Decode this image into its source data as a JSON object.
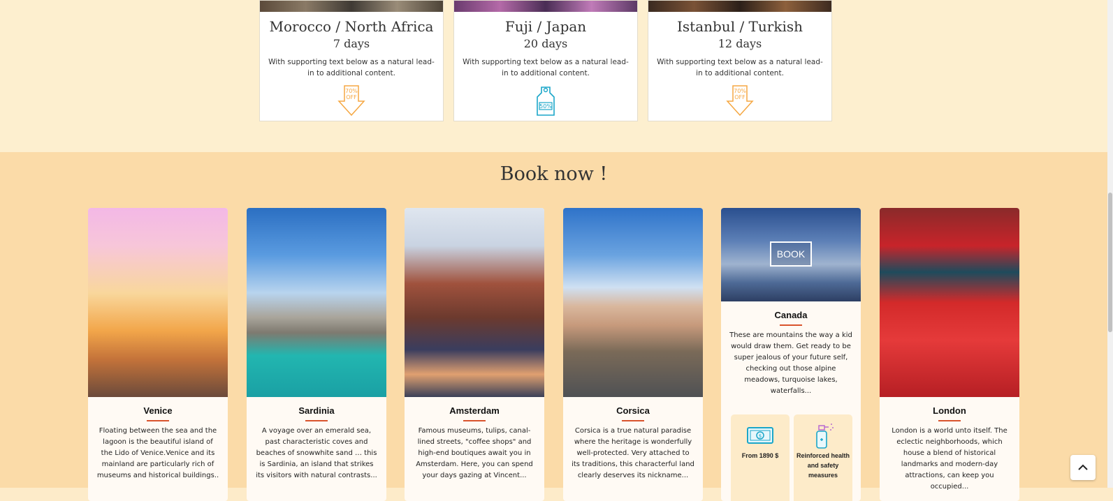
{
  "deals": [
    {
      "title": "Morocco / North Africa",
      "days": "7 days",
      "text": "With supporting text below as a natural lead-in to additional content.",
      "badge_icon": "70-percent-off-tag-icon",
      "badge_text": "70% OFF",
      "badge_color": "#f5a742"
    },
    {
      "title": "Fuji / Japan",
      "days": "20 days",
      "text": "With supporting text below as a natural lead-in to additional content.",
      "badge_icon": "50-percent-price-tag-icon",
      "badge_text": "50%",
      "badge_color": "#1aa6c9"
    },
    {
      "title": "Istanbul / Turkish",
      "days": "12 days",
      "text": "With supporting text below as a natural lead-in to additional content.",
      "badge_icon": "70-percent-off-tag-icon",
      "badge_text": "70% OFF",
      "badge_color": "#f5a742"
    }
  ],
  "book_section": {
    "title": "Book now !",
    "destinations": [
      {
        "name": "Venice",
        "desc": "Floating between the sea and the lagoon is the beautiful island of the Lido of Venice.Venice and its mainland are particularly rich of museums and historical buildings.."
      },
      {
        "name": "Sardinia",
        "desc": "A voyage over an emerald sea, past characteristic coves and beaches of snowwhite sand … this is Sardinia, an island that strikes its visitors with natural contrasts..."
      },
      {
        "name": "Amsterdam",
        "desc": "Famous museums, tulips, canal-lined streets, \"coffee shops\" and high-end boutiques await you in Amsterdam. Here, you can spend your days gazing at Vincent..."
      },
      {
        "name": "Corsica",
        "desc": "Corsica is a true natural paradise where the heritage is wonderfully well-protected. Very attached to its traditions, this characterful land clearly deserves its nickname..."
      },
      {
        "name": "London",
        "desc": "London is a world unto itself. The eclectic neighborhoods, which house a blend of historical landmarks and modern-day attractions, can keep you occupied..."
      }
    ],
    "featured": {
      "name": "Canada",
      "button": "BOOK",
      "desc": "These are mountains the way a kid would draw them. Get ready to be super jealous of your future self, checking out those alpine meadows, turquoise lakes, waterfalls...",
      "features": [
        {
          "label": "From 1890 $",
          "icon": "money-bill-icon"
        },
        {
          "label": "Reinforced health and safety measures",
          "icon": "sanitizer-spray-icon"
        }
      ]
    }
  },
  "colors": {
    "accent_line": "#d9532c",
    "band_light": "#fdefcf",
    "band_dark": "#fbdba8"
  }
}
